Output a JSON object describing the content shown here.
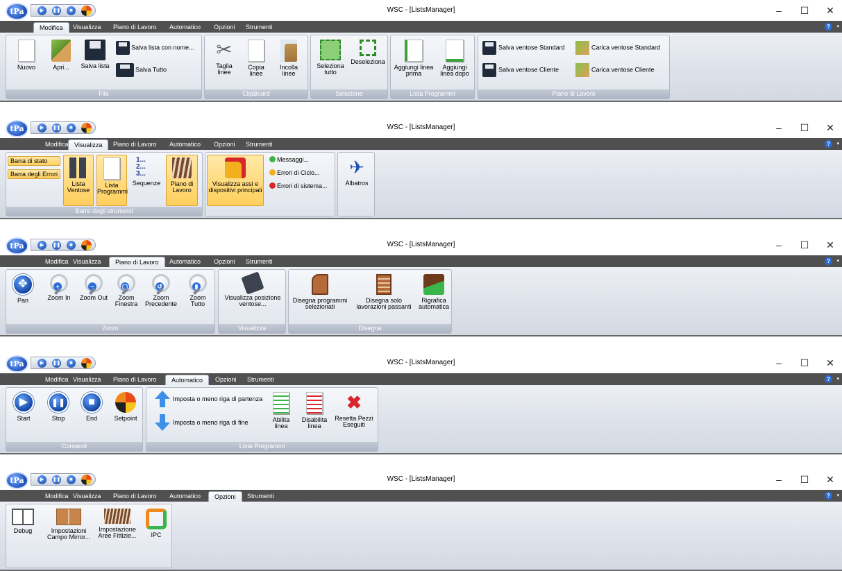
{
  "app": {
    "title": "WSC - [ListsManager]",
    "logo_text": "tPa",
    "tabs": [
      "Modifica",
      "Visualizza",
      "Piano di Lavoro",
      "Automatico",
      "Opzioni",
      "Strumenti"
    ],
    "qat_icons": [
      "play-icon",
      "pause-icon",
      "stop-icon",
      "setpoint-icon"
    ],
    "window_controls": {
      "minimize": "–",
      "maximize": "☐",
      "close": "✕"
    },
    "help_icon": "?",
    "help_caret": "▾"
  },
  "panels": [
    {
      "active_tab": "Modifica",
      "groups": [
        {
          "label": "File",
          "buttons": [
            {
              "label": "Nuovo",
              "icon": "new-document-icon"
            },
            {
              "label": "Apri...",
              "icon": "open-icon"
            },
            {
              "label": "Salva lista",
              "icon": "save-icon"
            }
          ],
          "small_buttons": [
            {
              "label": "Salva lista con nome...",
              "icon": "save-as-icon"
            },
            {
              "label": "Salva Tutto",
              "icon": "save-all-icon"
            }
          ]
        },
        {
          "label": "ClipBoard",
          "buttons": [
            {
              "label": "Taglia linee",
              "icon": "scissors-icon"
            },
            {
              "label": "Copia linee",
              "icon": "copy-icon"
            },
            {
              "label": "Incolla linee",
              "icon": "paste-icon"
            }
          ]
        },
        {
          "label": "Selezione",
          "buttons": [
            {
              "label": "Seleziona tutto",
              "icon": "select-all-icon"
            },
            {
              "label": "Deseleziona",
              "icon": "deselect-icon"
            }
          ]
        },
        {
          "label": "Lista Programmi",
          "buttons": [
            {
              "label": "Aggiungi linea prima",
              "icon": "add-line-before-icon"
            },
            {
              "label": "Aggiungi linea dopo",
              "icon": "add-line-after-icon"
            }
          ]
        },
        {
          "label": "Piano di Lavoro",
          "small_buttons": [
            {
              "label": "Salva ventose Standard",
              "icon": "save-suction-icon"
            },
            {
              "label": "Carica ventose Standard",
              "icon": "load-suction-icon"
            },
            {
              "label": "Salva ventose Cliente",
              "icon": "save-suction-icon"
            },
            {
              "label": "Carica ventose Cliente",
              "icon": "load-suction-icon"
            }
          ]
        }
      ]
    },
    {
      "active_tab": "Visualizza",
      "groups": [
        {
          "label": "Barre degli strumenti",
          "small_buttons": [
            {
              "label": "Barra di stato"
            },
            {
              "label": "Barra degli Errori"
            }
          ],
          "buttons": [
            {
              "label": "Lista Ventose",
              "icon": "suction-list-icon",
              "highlighted": true
            },
            {
              "label": "Lista Programmi",
              "icon": "program-list-icon",
              "highlighted": true
            },
            {
              "label": "Sequenze",
              "icon": "sequences-icon",
              "highlighted": false
            },
            {
              "label": "Piano di Lavoro",
              "icon": "worktable-icon",
              "highlighted": true
            }
          ]
        },
        {
          "label": "",
          "buttons": [
            {
              "label": "Visualizza assi e dispositivi principali",
              "icon": "axes-devices-icon",
              "highlighted": true
            }
          ],
          "small_buttons": [
            {
              "label": "Messaggi...",
              "led": "#3ab54a"
            },
            {
              "label": "Errori di Ciclo...",
              "led": "#f2b01e"
            },
            {
              "label": "Errori di sistema...",
              "led": "#d8262a"
            }
          ]
        },
        {
          "label": "",
          "buttons": [
            {
              "label": "Albatros",
              "icon": "albatros-icon"
            }
          ]
        }
      ]
    },
    {
      "active_tab": "Piano di Lavoro",
      "groups": [
        {
          "label": "Zoom",
          "buttons": [
            {
              "label": "Pan",
              "icon": "pan-icon"
            },
            {
              "label": "Zoom In",
              "icon": "zoom-in-icon",
              "sym": "+"
            },
            {
              "label": "Zoom Out",
              "icon": "zoom-out-icon",
              "sym": "−"
            },
            {
              "label": "Zoom Finestra",
              "icon": "zoom-window-icon",
              "sym": "▢"
            },
            {
              "label": "Zoom Precedente",
              "icon": "zoom-previous-icon",
              "sym": "↺"
            },
            {
              "label": "Zoom Tutto",
              "icon": "zoom-all-icon",
              "sym": "▮"
            }
          ]
        },
        {
          "label": "Visualizza",
          "buttons": [
            {
              "label": "Visualizza posizione ventose...",
              "icon": "suction-position-icon"
            }
          ]
        },
        {
          "label": "Disegna",
          "buttons": [
            {
              "label": "Disegna programmi selezionati",
              "icon": "draw-programs-icon"
            },
            {
              "label": "Disegna solo lavorazioni passanti",
              "icon": "draw-through-icon"
            },
            {
              "label": "Rigrafica automatica",
              "icon": "auto-redraw-icon"
            }
          ]
        }
      ]
    },
    {
      "active_tab": "Automatico",
      "groups": [
        {
          "label": "Comandi",
          "buttons": [
            {
              "label": "Start",
              "icon": "play-icon",
              "sym": "▶"
            },
            {
              "label": "Stop",
              "icon": "pause-icon",
              "sym": "❚❚"
            },
            {
              "label": "End",
              "icon": "stop-icon",
              "sym": "■"
            },
            {
              "label": "Setpoint",
              "icon": "setpoint-icon"
            }
          ]
        },
        {
          "label": "Lista Programmi",
          "small_buttons": [
            {
              "label": "Imposta o meno riga di partenza",
              "icon": "arrow-up-icon"
            },
            {
              "label": "Imposta o meno riga di fine",
              "icon": "arrow-down-icon"
            }
          ],
          "buttons": [
            {
              "label": "Abilita linea",
              "icon": "enable-line-icon"
            },
            {
              "label": "Disabilita linea",
              "icon": "disable-line-icon"
            },
            {
              "label": "Resetta Pezzi Eseguiti",
              "icon": "reset-pieces-icon"
            }
          ]
        }
      ]
    },
    {
      "active_tab": "Opzioni",
      "groups": [
        {
          "label": "",
          "buttons": [
            {
              "label": "Debug",
              "icon": "book-icon"
            },
            {
              "label": "Impostazioni Campo Mirror...",
              "icon": "mirror-field-icon"
            },
            {
              "label": "Impostazione Aree Fittizie...",
              "icon": "fictitious-areas-icon"
            },
            {
              "label": "IPC",
              "icon": "ipc-icon"
            }
          ]
        }
      ]
    }
  ]
}
